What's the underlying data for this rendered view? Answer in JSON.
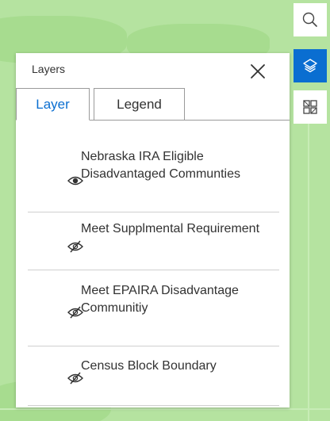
{
  "colors": {
    "accent": "#0a6ed1",
    "map_green": "#b5e3a0",
    "text": "#323232",
    "divider": "#cfcfcf"
  },
  "rail": {
    "buttons": [
      {
        "icon": "search-icon",
        "active": false
      },
      {
        "icon": "layers-icon",
        "active": true
      },
      {
        "icon": "basemap-gallery-icon",
        "active": false
      }
    ]
  },
  "panel": {
    "title": "Layers",
    "close_icon": "close-icon",
    "tabs": [
      {
        "label": "Layer",
        "active": true
      },
      {
        "label": "Legend",
        "active": false
      }
    ],
    "layers": [
      {
        "name": "Nebraska IRA Eligible Disadvantaged Communties",
        "visible": true,
        "icon": "eye-icon"
      },
      {
        "name": "Meet Supplmental Requirement",
        "visible": false,
        "icon": "eye-hidden-icon"
      },
      {
        "name": "Meet EPAIRA Disadvantage Communitiy",
        "visible": false,
        "icon": "eye-hidden-icon"
      },
      {
        "name": "Census Block Boundary",
        "visible": false,
        "icon": "eye-hidden-icon"
      }
    ]
  }
}
